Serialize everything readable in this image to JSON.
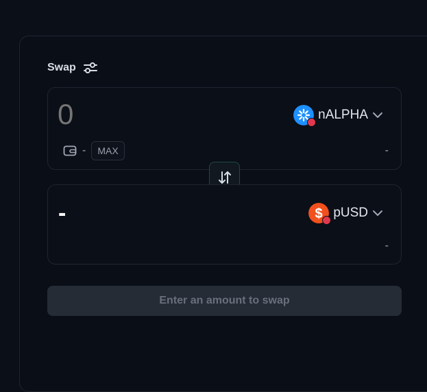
{
  "header": {
    "title": "Swap",
    "settings_icon": "sliders-icon"
  },
  "from": {
    "amount_placeholder": "0",
    "amount_value": "",
    "token": {
      "symbol": "nALPHA",
      "logo_icon": "nalpha-logo-icon",
      "color": "#1e90ff"
    },
    "balance": "-",
    "max_label": "MAX",
    "usd_value": "-"
  },
  "switch_icon": "arrows-up-down-icon",
  "to": {
    "amount": "-",
    "token": {
      "symbol": "pUSD",
      "logo_icon": "pusd-logo-icon",
      "color": "#f2501c"
    },
    "usd_value": "-"
  },
  "submit": {
    "label": "Enter an amount to swap"
  },
  "colors": {
    "background": "#0b0f18",
    "panel_border": "#1f2631",
    "swap_button_border": "#1e4a45",
    "disabled_button": "#262c36",
    "badge": "#e2384d"
  }
}
